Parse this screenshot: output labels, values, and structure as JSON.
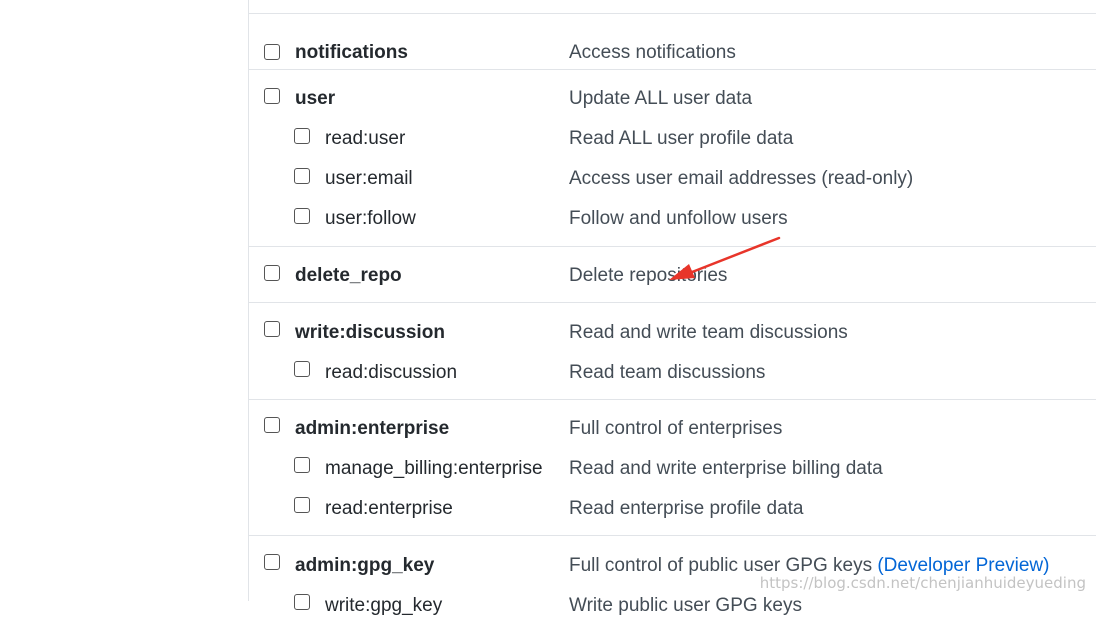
{
  "scopes": [
    {
      "name": "notifications",
      "desc": "Access notifications",
      "children": []
    },
    {
      "name": "user",
      "desc": "Update ALL user data",
      "children": [
        {
          "name": "read:user",
          "desc": "Read ALL user profile data"
        },
        {
          "name": "user:email",
          "desc": "Access user email addresses (read-only)"
        },
        {
          "name": "user:follow",
          "desc": "Follow and unfollow users"
        }
      ]
    },
    {
      "name": "delete_repo",
      "desc": "Delete repositories",
      "children": []
    },
    {
      "name": "write:discussion",
      "desc": "Read and write team discussions",
      "children": [
        {
          "name": "read:discussion",
          "desc": "Read team discussions"
        }
      ]
    },
    {
      "name": "admin:enterprise",
      "desc": "Full control of enterprises",
      "children": [
        {
          "name": "manage_billing:enterprise",
          "desc": "Read and write enterprise billing data"
        },
        {
          "name": "read:enterprise",
          "desc": "Read enterprise profile data"
        }
      ]
    },
    {
      "name": "admin:gpg_key",
      "desc": "Full control of public user GPG keys",
      "desc_link": "(Developer Preview)",
      "children": [
        {
          "name": "write:gpg_key",
          "desc": "Write public user GPG keys"
        }
      ]
    }
  ],
  "annotation": {
    "color": "#e8352a"
  },
  "watermark": "https://blog.csdn.net/chenjianhuideyueding"
}
